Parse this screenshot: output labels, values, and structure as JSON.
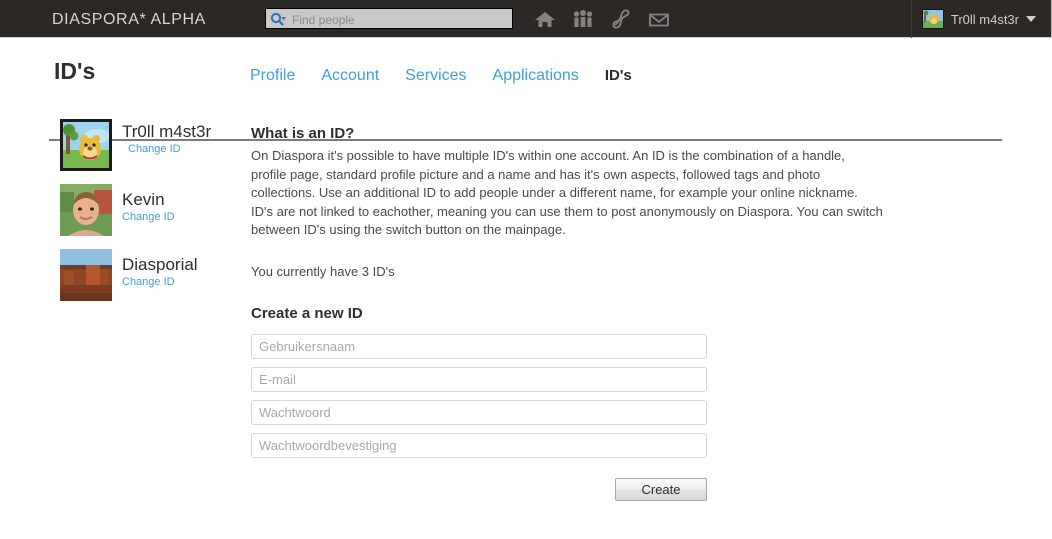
{
  "topbar": {
    "brand": "DIASPORA* ALPHA",
    "search": {
      "placeholder": "Find people",
      "value": "",
      "icon": "search-icon"
    },
    "icons": [
      {
        "name": "home-icon",
        "label": "Home"
      },
      {
        "name": "contacts-icon",
        "label": "Contacts"
      },
      {
        "name": "activity-icon",
        "label": "Activity"
      },
      {
        "name": "mail-icon",
        "label": "Messages"
      }
    ],
    "user": {
      "name": "Tr0ll m4st3r",
      "caret": "▼"
    }
  },
  "header": {
    "title": "ID's",
    "tabs": [
      {
        "label": "Profile",
        "active": false
      },
      {
        "label": "Account",
        "active": false
      },
      {
        "label": "Services",
        "active": false
      },
      {
        "label": "Applications",
        "active": false
      },
      {
        "label": "ID's",
        "active": true
      }
    ]
  },
  "ids": {
    "change_label": "Change ID",
    "items": [
      {
        "name": "Tr0ll m4st3r",
        "change_label": "Change ID",
        "avatar": "cartoon-bear-avatar"
      },
      {
        "name": "Kevin",
        "change_label": "Change ID",
        "avatar": "portrait-photo-avatar"
      },
      {
        "name": "Diasporial",
        "change_label": "Change ID",
        "avatar": "desert-mesa-avatar"
      }
    ]
  },
  "main": {
    "what_is_heading": "What is an ID?",
    "what_is_body": "On Diaspora it's possible to have multiple ID's within one account. An ID is the combination of a handle, profile page, standard profile picture and a name and has it's own aspects, followed tags and photo collections. Use an additional ID to add people under a different name, for example your online nickname. ID's are not linked to eachother, meaning you can use them to post anonymously on Diaspora. You can switch between ID's using the switch button on the mainpage.",
    "count_line": "You currently have 3 ID's",
    "create_heading": "Create a new ID",
    "form": {
      "username": {
        "placeholder": "Gebruikersnaam",
        "value": ""
      },
      "email": {
        "placeholder": "E-mail",
        "value": ""
      },
      "password": {
        "placeholder": "Wachtwoord",
        "value": ""
      },
      "password_confirm": {
        "placeholder": "Wachtwoordbevestiging",
        "value": ""
      },
      "submit_label": "Create"
    }
  },
  "colors": {
    "topbar_bg": "#2b2826",
    "link_blue": "#3f9fd8",
    "text_dark": "#2e2e2e",
    "rule_gray": "#7b7b7b"
  }
}
